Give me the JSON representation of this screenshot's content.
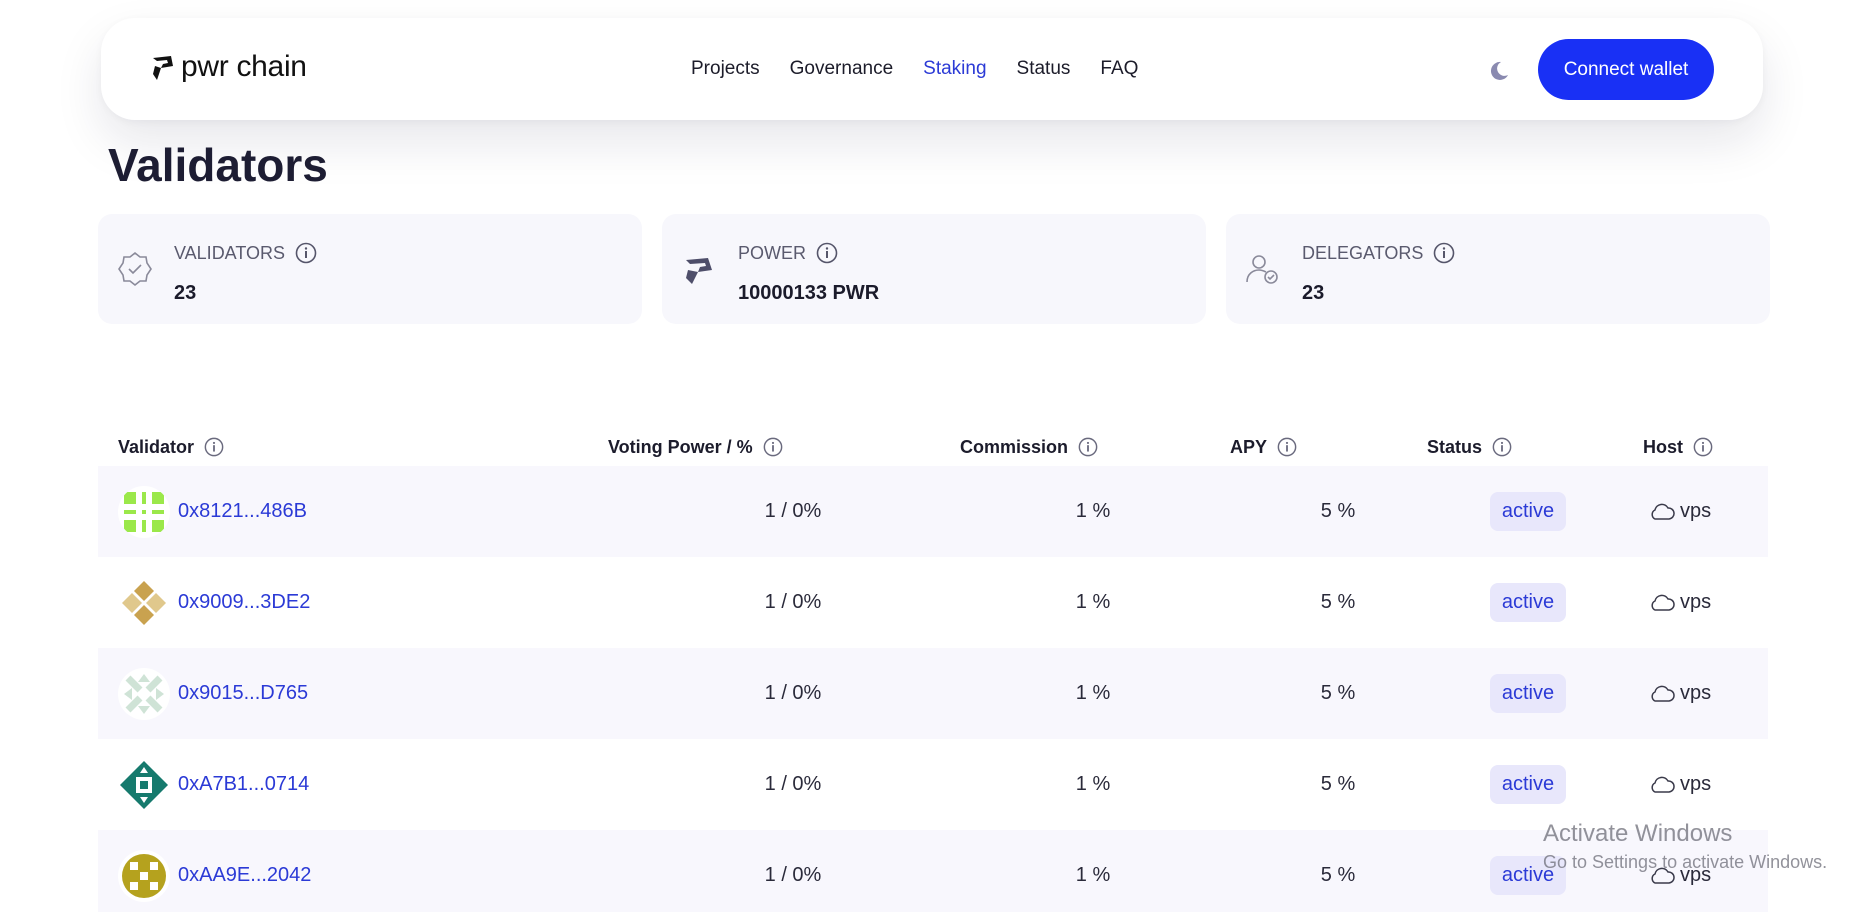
{
  "brand": {
    "name": "pwr chain"
  },
  "nav": {
    "links": [
      "Projects",
      "Governance",
      "Staking",
      "Status",
      "FAQ"
    ],
    "active": "Staking",
    "connect_label": "Connect wallet"
  },
  "page": {
    "title": "Validators"
  },
  "stats": [
    {
      "label": "VALIDATORS",
      "value": "23",
      "icon": "verified-badge-icon"
    },
    {
      "label": "POWER",
      "value": "10000133 PWR",
      "icon": "pwr-logo-icon"
    },
    {
      "label": "DELEGATORS",
      "value": "23",
      "icon": "user-check-icon"
    }
  ],
  "table": {
    "columns": [
      "Validator",
      "Voting Power / %",
      "Commission",
      "APY",
      "Status",
      "Host"
    ],
    "rows": [
      {
        "address": "0x8121...486B",
        "voting_power": "1 / 0%",
        "commission": "1 %",
        "apy": "5 %",
        "status": "active",
        "host": "vps",
        "avatar_color": "#9be84a"
      },
      {
        "address": "0x9009...3DE2",
        "voting_power": "1 / 0%",
        "commission": "1 %",
        "apy": "5 %",
        "status": "active",
        "host": "vps",
        "avatar_color": "#c9a24f"
      },
      {
        "address": "0x9015...D765",
        "voting_power": "1 / 0%",
        "commission": "1 %",
        "apy": "5 %",
        "status": "active",
        "host": "vps",
        "avatar_color": "#cfe3d6"
      },
      {
        "address": "0xA7B1...0714",
        "voting_power": "1 / 0%",
        "commission": "1 %",
        "apy": "5 %",
        "status": "active",
        "host": "vps",
        "avatar_color": "#167a6d"
      },
      {
        "address": "0xAA9E...2042",
        "voting_power": "1 / 0%",
        "commission": "1 %",
        "apy": "5 %",
        "status": "active",
        "host": "vps",
        "avatar_color": "#b5a21e"
      }
    ]
  },
  "watermark": {
    "title": "Activate Windows",
    "subtitle": "Go to Settings to activate Windows."
  },
  "colors": {
    "accent": "#1930f5",
    "link": "#2b3ad6",
    "card_bg": "#f7f7fc",
    "badge_bg": "#e8e7fb"
  }
}
